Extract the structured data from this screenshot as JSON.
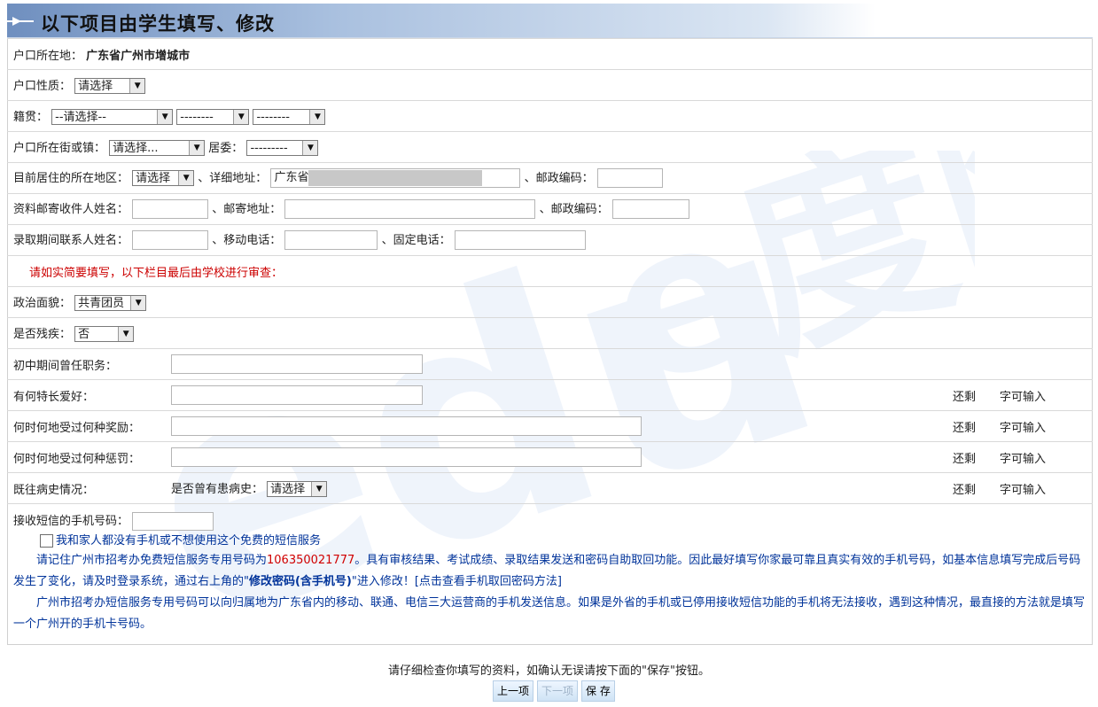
{
  "header": {
    "title": "以下项目由学生填写、修改"
  },
  "rows": {
    "hukou_loc_label": "户口所在地：",
    "hukou_loc_value": "广东省广州市增城市",
    "hukou_type_label": "户口性质：",
    "hukou_type_value": "请选择",
    "jiguan_label": "籍贯：",
    "jiguan_sel1": "--请选择--",
    "jiguan_sel2": "--------",
    "jiguan_sel3": "--------",
    "street_label": "户口所在街或镇：",
    "street_value": "请选择...",
    "juwei_label": "居委：",
    "juwei_value": "---------",
    "current_area_label": "目前居住的所在地区：",
    "current_area_value": "请选择",
    "detail_addr_label": "、详细地址：",
    "detail_addr_value": "广东省",
    "postcode_label1": "、邮政编码：",
    "mail_name_label": "资料邮寄收件人姓名：",
    "mail_addr_label": "、邮寄地址：",
    "postcode_label2": "、邮政编码：",
    "contact_name_label": "录取期间联系人姓名：",
    "mobile_label": "、移动电话：",
    "phone_label": "、固定电话：",
    "notice": "请如实简要填写，以下栏目最后由学校进行审查：",
    "political_label": "政治面貌：",
    "political_value": "共青团员",
    "disabled_label": "是否残疾：",
    "disabled_value": "否",
    "duty_label": "初中期间曾任职务：",
    "hobby_label": "有何特长爱好：",
    "award_label": "何时何地受过何种奖励：",
    "punish_label": "何时何地受过何种惩罚：",
    "disease_label": "既往病史情况：",
    "disease_q_label": "是否曾有患病史：",
    "disease_q_value": "请选择",
    "remain_label": "还剩",
    "remain_suffix": "字可输入"
  },
  "sms": {
    "phone_label": "接收短信的手机号码：",
    "checkbox_label": "我和家人都没有手机或不想使用这个免费的短信服务",
    "p1_a": "请记住广州市招考办免费短信服务专用号码为",
    "p1_number": "106350021777",
    "p1_b": "。具有审核结果、考试成绩、录取结果发送和密码自助取回功能。因此最好填写你家最可靠且真实有效的手机号码，如基本信息填写完成后号码发生了变化，请及时登录系统，通过右上角的\"",
    "p1_bold": "修改密码(含手机号)",
    "p1_c": "\"进入修改！",
    "p1_link": "[点击查看手机取回密码方法]",
    "p2": "广州市招考办短信服务专用号码可以向归属地为广东省内的移动、联通、电信三大运营商的手机发送信息。如果是外省的手机或已停用接收短信功能的手机将无法接收，遇到这种情况，最直接的方法就是填写一个广州开的手机卡号码。"
  },
  "footer": {
    "text": "请仔细检查你填写的资料，如确认无误请按下面的\"保存\"按钮。",
    "prev": "上一项",
    "next": "下一项",
    "save": "保 存"
  },
  "watermark": "edu.e度网",
  "colors": {
    "red": "#cc0000",
    "blue": "#00339a",
    "header_start": "#6f8fbf"
  }
}
